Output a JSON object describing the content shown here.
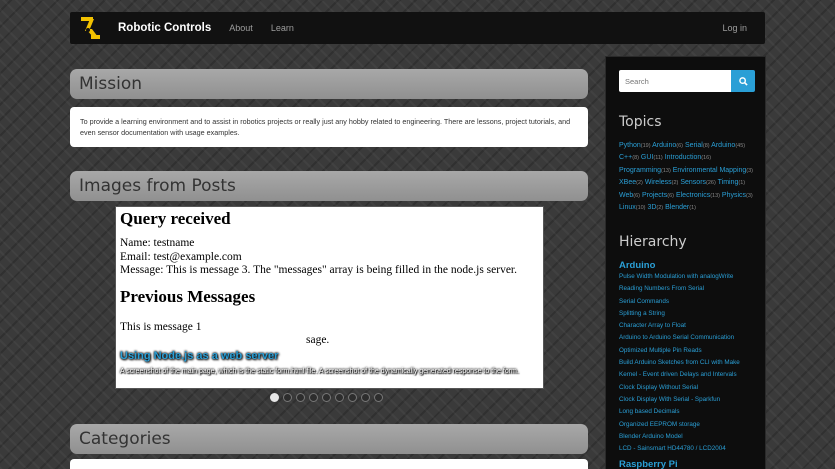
{
  "nav": {
    "brand": "Robotic Controls",
    "links": [
      "About",
      "Learn"
    ],
    "login": "Log in"
  },
  "mission": {
    "title": "Mission",
    "text": "To provide a learning environment and to assist in robotics projects or really just any hobby related to engineering. There are lessons, project tutorials, and even sensor documentation with usage examples."
  },
  "images": {
    "title": "Images from Posts",
    "slide": {
      "heading1": "Query received",
      "line1": "Name: testname",
      "line2": "Email: test@example.com",
      "line3": "Message: This is message 3. The \"messages\" array is being filled in the node.js server.",
      "heading2": "Previous Messages",
      "line4": "This is message 1",
      "line5_tail": "sage."
    },
    "caption_title": "Using Node.js as a web server",
    "caption_text": "A screenshot of the main page, which is the static form.html file. A screenshot of the dynamically generated response to the form.",
    "indicator_count": 9,
    "active_index": 0
  },
  "categories": {
    "title": "Categories"
  },
  "sidebar": {
    "search_placeholder": "Search",
    "topics_title": "Topics",
    "topics": [
      {
        "name": "Python",
        "count": "(19)"
      },
      {
        "name": "Arduino",
        "count": "(6)"
      },
      {
        "name": "Serial",
        "count": "(8)"
      },
      {
        "name": "Arduino",
        "count": "(45)"
      },
      {
        "name": "C++",
        "count": "(8)"
      },
      {
        "name": "GUI",
        "count": "(11)"
      },
      {
        "name": "Introduction",
        "count": "(16)"
      },
      {
        "name": "Programming",
        "count": "(13)"
      },
      {
        "name": "Environmental Mapping",
        "count": "(3)"
      },
      {
        "name": "XBee",
        "count": "(2)"
      },
      {
        "name": "Wireless",
        "count": "(2)"
      },
      {
        "name": "Sensors",
        "count": "(26)"
      },
      {
        "name": "Timing",
        "count": "(1)"
      },
      {
        "name": "Web",
        "count": "(6)"
      },
      {
        "name": "Projects",
        "count": "(6)"
      },
      {
        "name": "Electronics",
        "count": "(13)"
      },
      {
        "name": "Physics",
        "count": "(3)"
      },
      {
        "name": "Linux",
        "count": "(10)"
      },
      {
        "name": "3D",
        "count": "(2)"
      },
      {
        "name": "Blender",
        "count": "(1)"
      }
    ],
    "hierarchy_title": "Hierarchy",
    "hierarchy_category": "Arduino",
    "hierarchy_items": [
      "Pulse Width Modulation with analogWrite",
      "Reading Numbers From Serial",
      "Serial Commands",
      "Splitting a String",
      "Character Array to Float",
      "Arduino to Arduino Serial Communication",
      "Optimized Multiple Pin Reads",
      "Build Arduino Sketches from CLI with Make",
      "Kernel - Event driven Delays and Intervals",
      "Clock Display Without Serial",
      "Clock Display With Serial - Sparkfun",
      "Long based Decimals",
      "Organized EEPROM storage",
      "Blender Arduino Model",
      "LCD - Sainsmart HD44780 / LCD2004"
    ],
    "hierarchy_category2": "Raspberry Pi"
  }
}
